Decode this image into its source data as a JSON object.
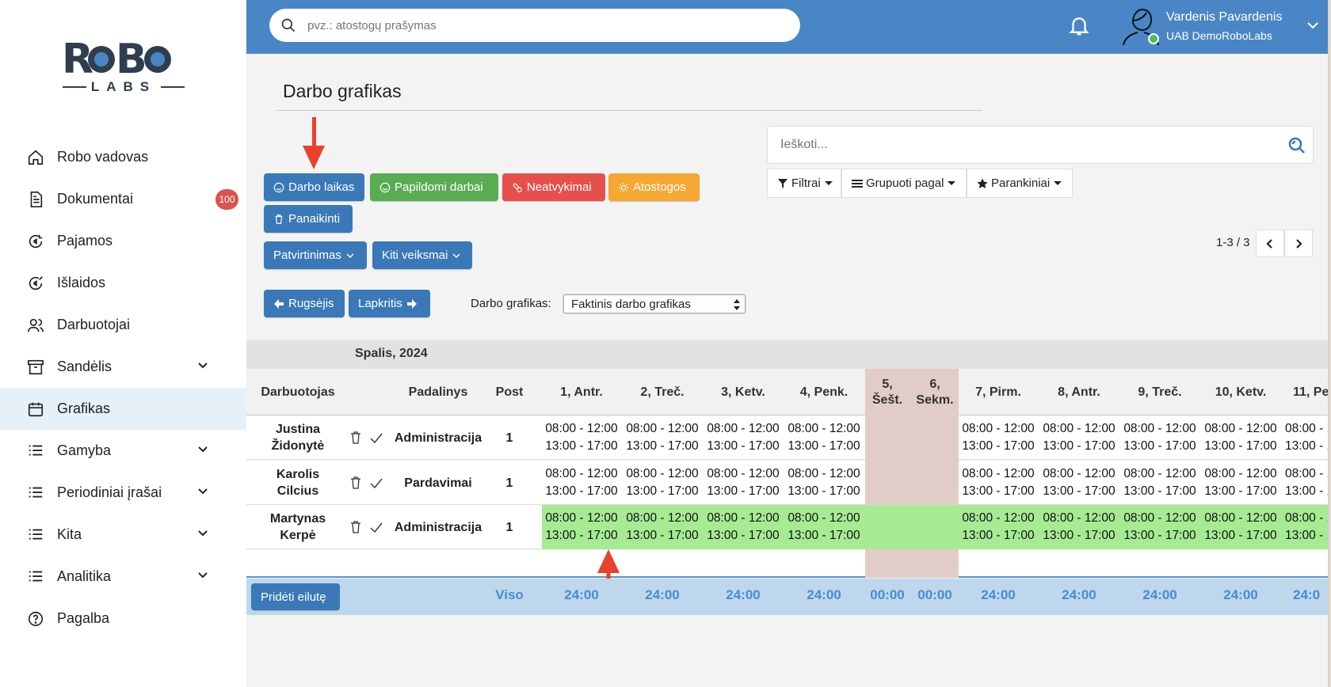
{
  "logo": {
    "main": "ROBO",
    "sub": "LABS"
  },
  "sidebar": {
    "items": [
      {
        "label": "Robo vadovas",
        "icon": "home-icon"
      },
      {
        "label": "Dokumentai",
        "icon": "document-icon",
        "badge": "100"
      },
      {
        "label": "Pajamos",
        "icon": "euro-income-icon"
      },
      {
        "label": "Išlaidos",
        "icon": "euro-expense-icon"
      },
      {
        "label": "Darbuotojai",
        "icon": "users-icon"
      },
      {
        "label": "Sandėlis",
        "icon": "archive-icon",
        "expandable": true
      },
      {
        "label": "Grafikas",
        "icon": "calendar-icon",
        "active": true
      },
      {
        "label": "Gamyba",
        "icon": "list-icon",
        "expandable": true
      },
      {
        "label": "Periodiniai įrašai",
        "icon": "list-icon",
        "expandable": true
      },
      {
        "label": "Kita",
        "icon": "list-icon",
        "expandable": true
      },
      {
        "label": "Analitika",
        "icon": "list-icon",
        "expandable": true
      },
      {
        "label": "Pagalba",
        "icon": "help-icon"
      }
    ]
  },
  "topbar": {
    "search_placeholder": "pvz.: atostogų prašymas",
    "user_name": "Vardenis Pavardenis",
    "user_company": "UAB DemoRoboLabs"
  },
  "page": {
    "title": "Darbo grafikas",
    "buttons": {
      "darbo_laikas": "Darbo laikas",
      "papildomi_darbai": "Papildomi darbai",
      "neatvykimai": "Neatvykimai",
      "atostogos": "Atostogos",
      "panaikinti": "Panaikinti",
      "patvirtinimas": "Patvirtinimas",
      "kiti_veiksmai": "Kiti veiksmai",
      "prev_month": "Rugsėjis",
      "next_month": "Lapkritis",
      "add_row": "Pridėti eilutę"
    },
    "search_placeholder": "Ieškoti...",
    "filters": {
      "filtrai": "Filtrai",
      "grupuoti": "Grupuoti pagal",
      "parankiniai": "Parankiniai"
    },
    "pager": "1-3 / 3",
    "schedule_label": "Darbo grafikas:",
    "schedule_value": "Faktinis darbo grafikas",
    "colors": {
      "accent": "#4a86c5",
      "weekend": "#e2ccc7",
      "highlight_row": "#a6eb94",
      "total_text": "#4a8bd1"
    }
  },
  "table": {
    "month": "Spalis, 2024",
    "headers": {
      "employee": "Darbuotojas",
      "department": "Padalinys",
      "post": "Post",
      "days": [
        "1, Antr.",
        "2, Treč.",
        "3, Ketv.",
        "4, Penk.",
        "5,\nŠešt.",
        "6,\nSekm.",
        "7, Pirm.",
        "8, Antr.",
        "9, Treč.",
        "10, Ketv.",
        "11, Pe"
      ]
    },
    "rows": [
      {
        "name_line1": "Justina",
        "name_line2": "Židonytė",
        "department": "Administracija",
        "post": "1",
        "highlighted": false
      },
      {
        "name_line1": "Karolis",
        "name_line2": "Cilcius",
        "department": "Pardavimai",
        "post": "1",
        "highlighted": false
      },
      {
        "name_line1": "Martynas",
        "name_line2": "Kerpė",
        "department": "Administracija",
        "post": "1",
        "highlighted": true
      }
    ],
    "shift_morning": "08:00 - 12:00",
    "shift_afternoon": "13:00 - 17:00",
    "shift_morning_cut": "08:00 - 1",
    "shift_afternoon_cut": "13:00 - 1",
    "totals": {
      "label": "Viso",
      "values": [
        "24:00",
        "24:00",
        "24:00",
        "24:00",
        "00:00",
        "00:00",
        "24:00",
        "24:00",
        "24:00",
        "24:00",
        "24:0"
      ]
    }
  }
}
